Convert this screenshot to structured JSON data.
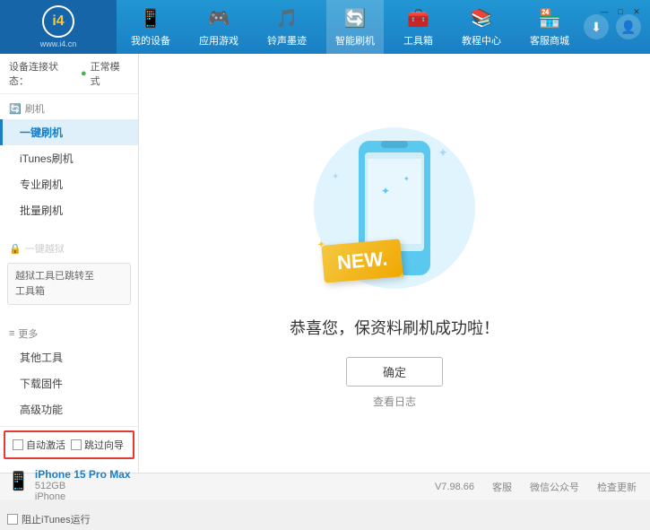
{
  "app": {
    "logo_circle": "i4",
    "logo_url": "www.i4.cn"
  },
  "nav": {
    "items": [
      {
        "id": "my-device",
        "icon": "📱",
        "label": "我的设备"
      },
      {
        "id": "apps-games",
        "icon": "🎮",
        "label": "应用游戏"
      },
      {
        "id": "ringtones",
        "icon": "🎵",
        "label": "铃声墨迹"
      },
      {
        "id": "smart-flash",
        "icon": "🔄",
        "label": "智能刷机",
        "active": true
      },
      {
        "id": "toolbox",
        "icon": "🧰",
        "label": "工具箱"
      },
      {
        "id": "tutorials",
        "icon": "📚",
        "label": "教程中心"
      },
      {
        "id": "services",
        "icon": "🏪",
        "label": "客服商城"
      }
    ]
  },
  "header_actions": {
    "download_icon": "⬇",
    "user_icon": "👤"
  },
  "sidebar": {
    "status_label": "设备连接状态：",
    "status_value": "正常模式",
    "sections": [
      {
        "header_icon": "🔄",
        "header_label": "刷机",
        "items": [
          {
            "id": "one-click-flash",
            "label": "一键刷机",
            "active": true
          },
          {
            "id": "itunes-flash",
            "label": "iTunes刷机"
          },
          {
            "id": "pro-flash",
            "label": "专业刷机"
          },
          {
            "id": "batch-flash",
            "label": "批量刷机"
          }
        ]
      },
      {
        "header_icon": "🔓",
        "header_label": "一键越狱",
        "disabled": true,
        "notice": "越狱工具已跳转至\n工具箱"
      }
    ],
    "more_section": {
      "header": "更多",
      "items": [
        {
          "id": "other-tools",
          "label": "其他工具"
        },
        {
          "id": "download-firmware",
          "label": "下载固件"
        },
        {
          "id": "advanced",
          "label": "高级功能"
        }
      ]
    },
    "auto_options": {
      "auto_activate": "自动激活",
      "skip_guidance": "跳过向导"
    },
    "device": {
      "name": "iPhone 15 Pro Max",
      "storage": "512GB",
      "type": "iPhone"
    },
    "itunes_label": "阻止iTunes运行"
  },
  "content": {
    "new_badge": "NEW.",
    "success_message": "恭喜您，保资料刷机成功啦！",
    "confirm_button": "确定",
    "log_link": "查看日志"
  },
  "footer": {
    "version": "V7.98.66",
    "items": [
      "客服",
      "微信公众号",
      "检查更新"
    ]
  },
  "window_controls": {
    "minimize": "—",
    "maximize": "□",
    "close": "✕"
  }
}
